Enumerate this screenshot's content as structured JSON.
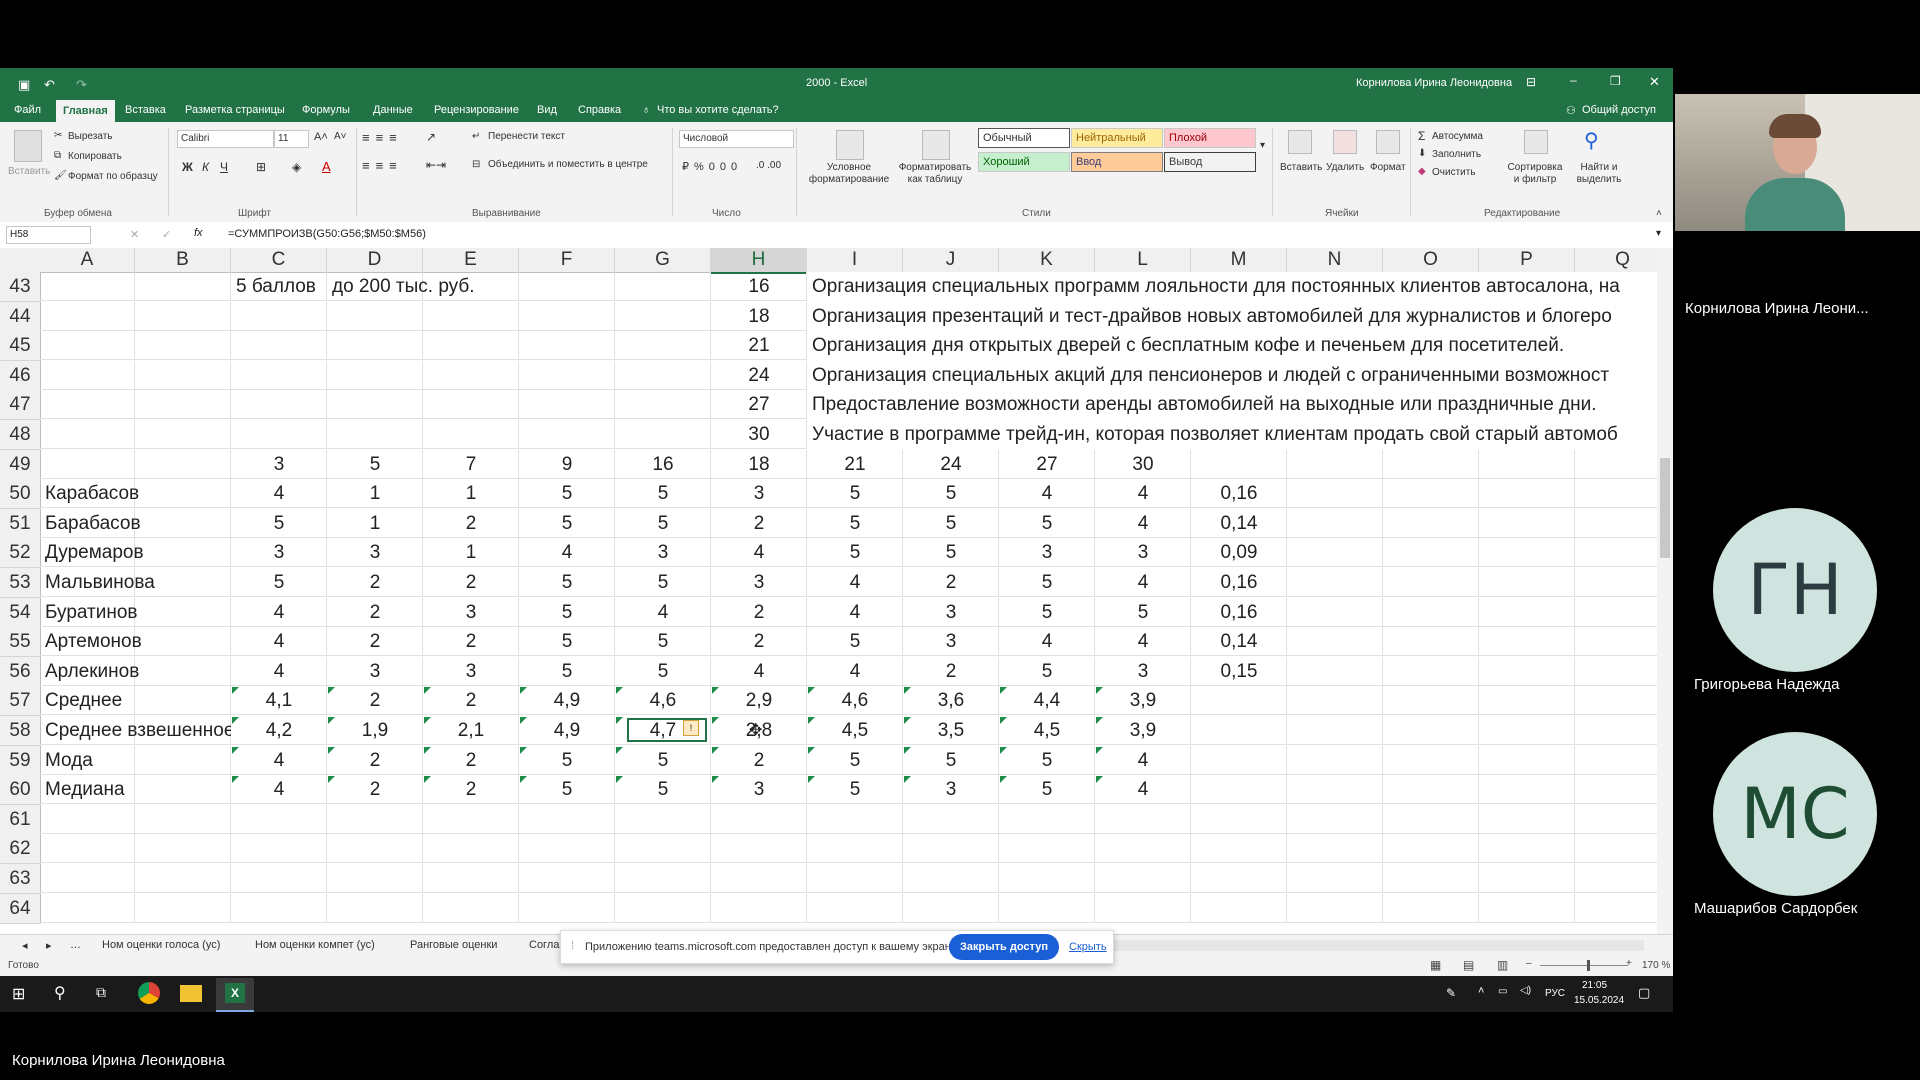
{
  "window": {
    "title": "2000 - Excel",
    "user": "Корнилова Ирина Леонидовна"
  },
  "menu": {
    "tabs": [
      "Файл",
      "Главная",
      "Вставка",
      "Разметка страницы",
      "Формулы",
      "Данные",
      "Рецензирование",
      "Вид",
      "Справка"
    ],
    "tell_me": "Что вы хотите сделать?",
    "share": "Общий доступ"
  },
  "ribbon": {
    "clipboard": {
      "paste": "Вставить",
      "cut": "Вырезать",
      "copy": "Копировать",
      "format_painter": "Формат по образцу",
      "group": "Буфер обмена"
    },
    "font": {
      "name": "Calibri",
      "size": "11",
      "group": "Шрифт"
    },
    "alignment": {
      "wrap": "Перенести текст",
      "merge": "Объединить и поместить в центре",
      "group": "Выравнивание"
    },
    "number": {
      "format": "Числовой",
      "group": "Число"
    },
    "styles": {
      "conditional": "Условное форматирование",
      "as_table": "Форматировать как таблицу",
      "normal": "Обычный",
      "neutral": "Нейтральный",
      "bad": "Плохой",
      "good": "Хороший",
      "input": "Ввод",
      "output": "Вывод",
      "group": "Стили"
    },
    "cells": {
      "insert": "Вставить",
      "delete": "Удалить",
      "format": "Формат",
      "group": "Ячейки"
    },
    "editing": {
      "autosum": "Автосумма",
      "fill": "Заполнить",
      "clear": "Очистить",
      "sort": "Сортировка и фильтр",
      "find": "Найти и выделить",
      "group": "Редактирование"
    }
  },
  "formula_bar": {
    "name_box": "H58",
    "fx": "fx",
    "formula": "=СУММПРОИЗВ(G50:G56;$M50:$M56)"
  },
  "grid": {
    "columns": [
      "A",
      "B",
      "C",
      "D",
      "E",
      "F",
      "G",
      "H",
      "I",
      "J",
      "K",
      "L",
      "M",
      "N",
      "O",
      "P",
      "Q"
    ],
    "selected_column": "H",
    "rows": [
      {
        "n": "43",
        "a": "",
        "vals": [
          "5 баллов",
          "до 200 тыс. руб.",
          "",
          "",
          "",
          "16"
        ],
        "text": "Организация специальных программ лояльности для постоянных клиентов автосалона, на"
      },
      {
        "n": "44",
        "a": "",
        "vals": [
          "",
          "",
          "",
          "",
          "",
          "18"
        ],
        "text": "Организация презентаций и тест-драйвов новых автомобилей для журналистов и блогеро"
      },
      {
        "n": "45",
        "a": "",
        "vals": [
          "",
          "",
          "",
          "",
          "",
          "21"
        ],
        "text": "Организация дня открытых дверей с бесплатным кофе и печеньем для посетителей."
      },
      {
        "n": "46",
        "a": "",
        "vals": [
          "",
          "",
          "",
          "",
          "",
          "24"
        ],
        "text": "Организация специальных акций для пенсионеров и людей с ограниченными возможност"
      },
      {
        "n": "47",
        "a": "",
        "vals": [
          "",
          "",
          "",
          "",
          "",
          "27"
        ],
        "text": "Предоставление возможности аренды автомобилей на выходные или праздничные дни."
      },
      {
        "n": "48",
        "a": "",
        "vals": [
          "",
          "",
          "",
          "",
          "",
          "30"
        ],
        "text": "Участие в программе трейд-ин, которая позволяет клиентам продать свой старый автомоб"
      },
      {
        "n": "49",
        "a": "",
        "vals": [
          "3",
          "5",
          "7",
          "9",
          "16",
          "18",
          "21",
          "24",
          "27",
          "30"
        ],
        "m": ""
      },
      {
        "n": "50",
        "a": "Карабасов",
        "vals": [
          "4",
          "1",
          "1",
          "5",
          "5",
          "3",
          "5",
          "5",
          "4",
          "4"
        ],
        "m": "0,16"
      },
      {
        "n": "51",
        "a": "Барабасов",
        "vals": [
          "5",
          "1",
          "2",
          "5",
          "5",
          "2",
          "5",
          "5",
          "5",
          "4"
        ],
        "m": "0,14"
      },
      {
        "n": "52",
        "a": "Дуремаров",
        "vals": [
          "3",
          "3",
          "1",
          "4",
          "3",
          "4",
          "5",
          "5",
          "3",
          "3"
        ],
        "m": "0,09"
      },
      {
        "n": "53",
        "a": "Мальвинова",
        "vals": [
          "5",
          "2",
          "2",
          "5",
          "5",
          "3",
          "4",
          "2",
          "5",
          "4"
        ],
        "m": "0,16"
      },
      {
        "n": "54",
        "a": "Буратинов",
        "vals": [
          "4",
          "2",
          "3",
          "5",
          "4",
          "2",
          "4",
          "3",
          "5",
          "5"
        ],
        "m": "0,16"
      },
      {
        "n": "55",
        "a": "Артемонов",
        "vals": [
          "4",
          "2",
          "2",
          "5",
          "5",
          "2",
          "5",
          "3",
          "4",
          "4"
        ],
        "m": "0,14"
      },
      {
        "n": "56",
        "a": "Арлекинов",
        "vals": [
          "4",
          "3",
          "3",
          "5",
          "5",
          "4",
          "4",
          "2",
          "5",
          "3"
        ],
        "m": "0,15"
      },
      {
        "n": "57",
        "a": "Среднее",
        "vals": [
          "4,1",
          "2",
          "2",
          "4,9",
          "4,6",
          "2,9",
          "4,6",
          "3,6",
          "4,4",
          "3,9"
        ],
        "m": "",
        "green": true
      },
      {
        "n": "58",
        "a": "Среднее взвешенное",
        "vals": [
          "4,2",
          "1,9",
          "2,1",
          "4,9",
          "4,7",
          "2,8",
          "4,5",
          "3,5",
          "4,5",
          "3,9"
        ],
        "m": "",
        "green": true
      },
      {
        "n": "59",
        "a": "Мода",
        "vals": [
          "4",
          "2",
          "2",
          "5",
          "5",
          "2",
          "5",
          "5",
          "5",
          "4"
        ],
        "m": "",
        "green": true
      },
      {
        "n": "60",
        "a": "Медиана",
        "vals": [
          "4",
          "2",
          "2",
          "5",
          "5",
          "3",
          "5",
          "3",
          "5",
          "4"
        ],
        "m": "",
        "green": true
      },
      {
        "n": "61",
        "a": "",
        "vals": [],
        "m": ""
      },
      {
        "n": "62",
        "a": "",
        "vals": [],
        "m": ""
      },
      {
        "n": "63",
        "a": "",
        "vals": [],
        "m": ""
      },
      {
        "n": "64",
        "a": "",
        "vals": [],
        "m": ""
      }
    ]
  },
  "sheet_tabs": [
    "Ном оценки голоса (ус)",
    "Ном оценки компет (ус)",
    "Ранговые оценки",
    "Согла"
  ],
  "status": {
    "ready": "Готово",
    "zoom": "170 %"
  },
  "share_banner": {
    "text": "Приложению teams.microsoft.com предоставлен доступ к вашему экрану.",
    "stop": "Закрыть доступ",
    "hide": "Скрыть"
  },
  "taskbar": {
    "lang": "РУС",
    "time": "21:05",
    "date": "15.05.2024"
  },
  "participants": [
    {
      "name": "Корнилова Ирина Леони...",
      "initials": ""
    },
    {
      "name": "Григорьева Надежда",
      "initials": "ГН"
    },
    {
      "name": "Машарибов Сардорбек",
      "initials": "МС"
    }
  ],
  "presenter_caption": "Корнилова Ирина Леонидовна",
  "colors": {
    "excel_green": "#217346",
    "accent_blue": "#1a5fd6",
    "avatar_bg": "#cfe3df"
  }
}
